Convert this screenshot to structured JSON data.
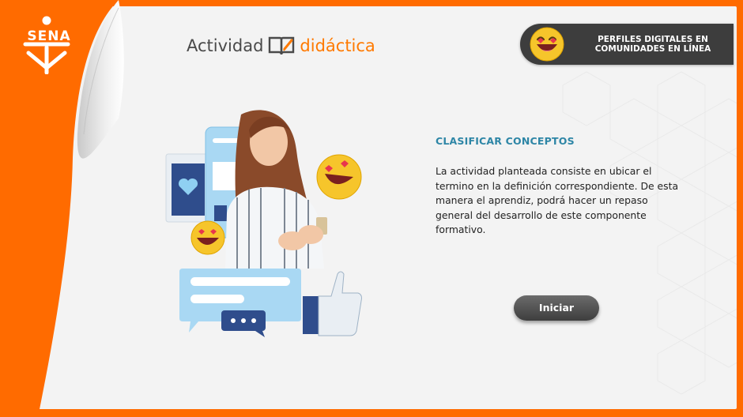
{
  "logo": {
    "text": "SENA"
  },
  "brand": {
    "part1": "Actividad",
    "part2": "didáctica"
  },
  "header_pill": {
    "title": "PERFILES DIGITALES EN COMUNIDADES EN LÍNEA",
    "line1": "PERFILES DIGITALES EN",
    "line2": "COMUNIDADES EN LÍNEA",
    "emoji": "laughing-emoji-icon"
  },
  "main": {
    "title": "CLASIFICAR CONCEPTOS",
    "description": "La actividad planteada consiste en ubicar el termino en la definición correspondiente. De esta manera el aprendiz, podrá hacer un repaso general del desarrollo de este componente formativo."
  },
  "start_button": {
    "label": "Iniciar"
  },
  "colors": {
    "frame": "#ff6b00",
    "accent": "#ff7a00",
    "title": "#2e86a6",
    "pill": "#3d3d3d",
    "button": "#4a4a4a"
  }
}
